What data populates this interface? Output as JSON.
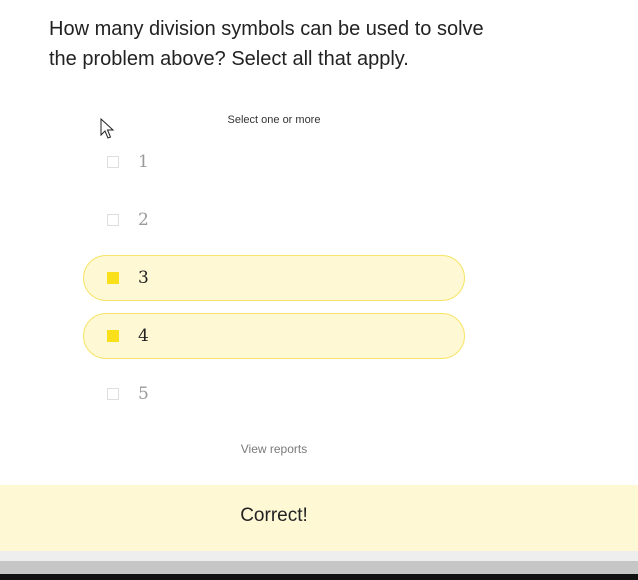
{
  "question": {
    "line1": "How many division symbols can be used to solve",
    "line2": "the problem above? Select all that apply."
  },
  "instruction": "Select one or more",
  "options": [
    {
      "label": "1",
      "selected": false
    },
    {
      "label": "2",
      "selected": false
    },
    {
      "label": "3",
      "selected": true
    },
    {
      "label": "4",
      "selected": true
    },
    {
      "label": "5",
      "selected": false
    }
  ],
  "view_reports_label": "View reports",
  "feedback": {
    "text": "Correct!"
  },
  "colors": {
    "selected_fill": "#fff8d5",
    "selected_border": "#f6e56a",
    "checkbox_checked": "#f9e01a"
  }
}
